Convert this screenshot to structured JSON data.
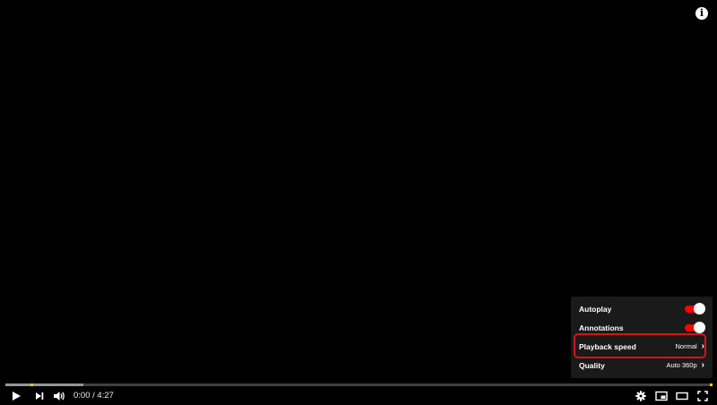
{
  "info_icon": "i",
  "settings": {
    "items": [
      {
        "label": "Autoplay",
        "type": "toggle",
        "on": true
      },
      {
        "label": "Annotations",
        "type": "toggle",
        "on": true
      },
      {
        "label": "Playback speed",
        "value": "Normal",
        "type": "submenu"
      },
      {
        "label": "Quality",
        "value": "Auto 360p",
        "type": "submenu"
      }
    ]
  },
  "controls": {
    "time_current": "0:00",
    "time_separator": "/",
    "time_total": "4:27",
    "icons": [
      "play-icon",
      "next-icon",
      "volume-icon",
      "settings-gear-icon",
      "miniplayer-icon",
      "theater-mode-icon",
      "fullscreen-icon"
    ]
  },
  "progress": {
    "played_fraction": 0.0,
    "buffered_fraction": 0.11
  },
  "colors": {
    "accent": "#ff0000",
    "highlight": "#d2151b",
    "marker": "#f5c518"
  }
}
